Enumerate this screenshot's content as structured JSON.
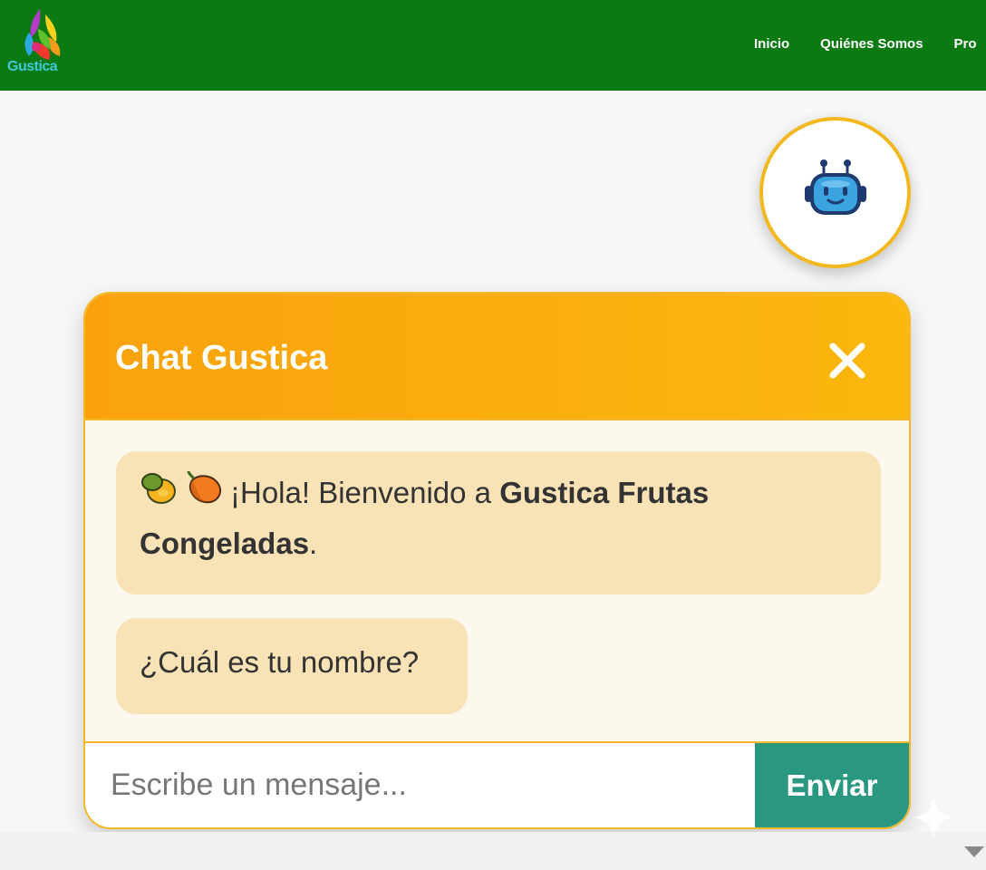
{
  "header": {
    "brand": "Gustica",
    "nav": [
      "Inicio",
      "Quiénes Somos",
      "Pro"
    ]
  },
  "chat": {
    "title": "Chat Gustica",
    "messages": {
      "welcome_prefix": "¡Hola! Bienvenido a ",
      "welcome_brand_line1": "Gustica Frutas",
      "welcome_brand_line2": "Congeladas",
      "welcome_suffix": ".",
      "question": "¿Cuál es tu nombre?"
    },
    "input_placeholder": "Escribe un mensaje...",
    "send_label": "Enviar"
  },
  "colors": {
    "header_green": "#0c7a12",
    "chat_orange": "#f9a20d",
    "bubble": "#f8e2b6",
    "send": "#2a9880"
  },
  "icons": [
    "logo-icon",
    "robot-icon",
    "close-icon",
    "papaya-icon",
    "mango-icon",
    "sparkle-icon",
    "scroll-down-icon"
  ]
}
